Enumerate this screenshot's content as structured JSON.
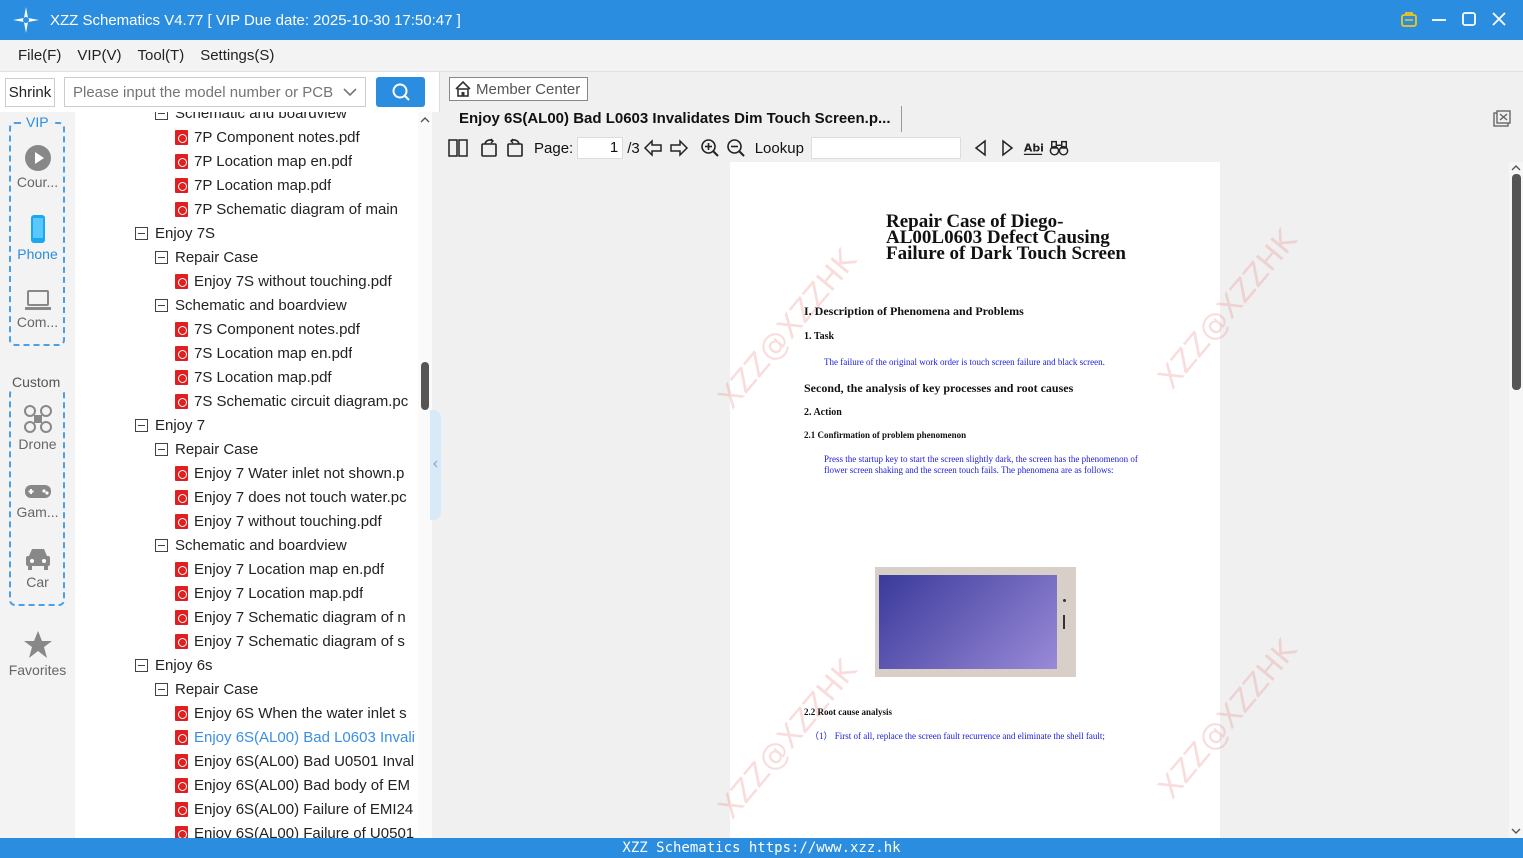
{
  "window": {
    "title": "XZZ Schematics V4.77 [ VIP Due date: 2025-10-30 17:50:47 ]"
  },
  "menu": [
    "File(F)",
    "VIP(V)",
    "Tool(T)",
    "Settings(S)"
  ],
  "search": {
    "shrink_label": "Shrink",
    "placeholder": "Please input the model number or PCB"
  },
  "sidebar": {
    "vip_label": "VIP",
    "custom_label": "Custom",
    "items": [
      {
        "label": "Cour...",
        "icon": "play-icon"
      },
      {
        "label": "Phone",
        "icon": "phone-icon"
      },
      {
        "label": "Com...",
        "icon": "laptop-icon"
      },
      {
        "label": "Drone",
        "icon": "drone-icon"
      },
      {
        "label": "Gam...",
        "icon": "gamepad-icon"
      },
      {
        "label": "Car",
        "icon": "car-icon"
      },
      {
        "label": "Favorites",
        "icon": "star-icon"
      }
    ]
  },
  "tree": [
    {
      "level": 1,
      "type": "folder",
      "label": "Schematic and boardview"
    },
    {
      "level": 2,
      "type": "pdf",
      "label": "7P Component notes.pdf"
    },
    {
      "level": 2,
      "type": "pdf",
      "label": "7P Location map en.pdf"
    },
    {
      "level": 2,
      "type": "pdf",
      "label": "7P Location map.pdf"
    },
    {
      "level": 2,
      "type": "pdf",
      "label": "7P Schematic diagram of main"
    },
    {
      "level": 0,
      "type": "folder",
      "label": "Enjoy 7S"
    },
    {
      "level": 1,
      "type": "folder",
      "label": "Repair Case"
    },
    {
      "level": 2,
      "type": "pdf",
      "label": "Enjoy 7S without touching.pdf"
    },
    {
      "level": 1,
      "type": "folder",
      "label": "Schematic and boardview"
    },
    {
      "level": 2,
      "type": "pdf",
      "label": "7S Component notes.pdf"
    },
    {
      "level": 2,
      "type": "pdf",
      "label": "7S Location map en.pdf"
    },
    {
      "level": 2,
      "type": "pdf",
      "label": "7S Location map.pdf"
    },
    {
      "level": 2,
      "type": "pdf",
      "label": "7S Schematic circuit diagram.pc"
    },
    {
      "level": 0,
      "type": "folder",
      "label": "Enjoy 7"
    },
    {
      "level": 1,
      "type": "folder",
      "label": "Repair Case"
    },
    {
      "level": 2,
      "type": "pdf",
      "label": "Enjoy 7 Water inlet not shown.p"
    },
    {
      "level": 2,
      "type": "pdf",
      "label": "Enjoy 7 does not touch water.pc"
    },
    {
      "level": 2,
      "type": "pdf",
      "label": "Enjoy 7 without touching.pdf"
    },
    {
      "level": 1,
      "type": "folder",
      "label": "Schematic and boardview"
    },
    {
      "level": 2,
      "type": "pdf",
      "label": "Enjoy 7 Location map en.pdf"
    },
    {
      "level": 2,
      "type": "pdf",
      "label": "Enjoy 7 Location map.pdf"
    },
    {
      "level": 2,
      "type": "pdf",
      "label": "Enjoy 7 Schematic diagram of n"
    },
    {
      "level": 2,
      "type": "pdf",
      "label": "Enjoy 7 Schematic diagram of s"
    },
    {
      "level": 0,
      "type": "folder",
      "label": "Enjoy 6s"
    },
    {
      "level": 1,
      "type": "folder",
      "label": "Repair Case"
    },
    {
      "level": 2,
      "type": "pdf",
      "label": "Enjoy 6S When the water inlet s"
    },
    {
      "level": 2,
      "type": "pdf",
      "label": "Enjoy 6S(AL00) Bad L0603 Invali",
      "selected": true
    },
    {
      "level": 2,
      "type": "pdf",
      "label": "Enjoy 6S(AL00) Bad U0501 Inval"
    },
    {
      "level": 2,
      "type": "pdf",
      "label": "Enjoy 6S(AL00) Bad body of EM"
    },
    {
      "level": 2,
      "type": "pdf",
      "label": "Enjoy 6S(AL00) Failure of EMI24"
    },
    {
      "level": 2,
      "type": "pdf",
      "label": "Enjoy 6S(AL00) Failure of U0501"
    }
  ],
  "viewer": {
    "member_center": "Member Center",
    "tab_title": "Enjoy 6S(AL00) Bad L0603 Invalidates Dim Touch Screen.p...",
    "page_label": "Page:",
    "page_current": "1",
    "page_total": "/3",
    "lookup_label": "Lookup",
    "lookup_value": ""
  },
  "document": {
    "title_lines": [
      "Repair Case of Diego-",
      "AL00L0603 Defect Causing",
      "Failure of Dark Touch Screen"
    ],
    "section1": "I. Description of Phenomena and Problems",
    "task_heading": "1. Task",
    "task_text": "The failure of the original work order is touch screen failure and black screen.",
    "section2": "Second, the analysis of key processes and root causes",
    "action_heading": "2. Action",
    "confirm_heading": "2.1  Confirmation of problem phenomenon",
    "confirm_text": "Press the startup key to start the screen slightly dark, the screen has the phenomenon of flower screen shaking and the screen touch fails. The phenomena are as follows:",
    "root_heading": "2.2  Root cause analysis",
    "root_text": "（1） First of all, replace the screen fault recurrence and eliminate the shell fault;",
    "watermark": "XZZ@XZZHK"
  },
  "status": "XZZ Schematics https://www.xzz.hk",
  "colors": {
    "accent": "#2a8de0",
    "selected": "#3a8ee6",
    "pdf_red": "#e02020"
  }
}
